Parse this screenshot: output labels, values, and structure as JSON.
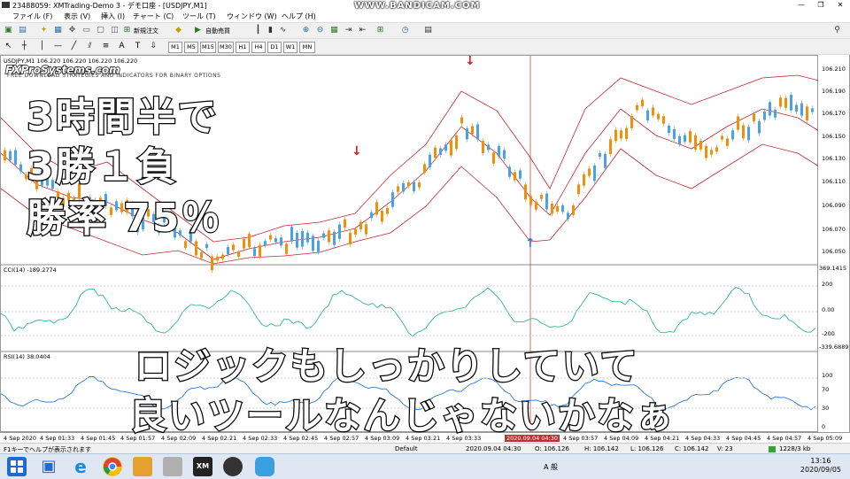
{
  "window": {
    "title": "23488059: XMTrading-Demo 3 - デモ口座 - [USDJPY,M1]",
    "watermark": "WWW.BANDICAM.COM",
    "min": "—",
    "max": "❐",
    "close": "✕"
  },
  "menu": [
    "ファイル (F)",
    "表示 (V)",
    "挿入 (I)",
    "チャート (C)",
    "ツール (T)",
    "ウィンドウ (W)",
    "ヘルプ (H)"
  ],
  "toolbar": {
    "new_order": "新規注文",
    "auto_trade": "自動売買",
    "timeframes": [
      "M1",
      "M5",
      "M15",
      "M30",
      "H1",
      "H4",
      "D1",
      "W1",
      "MN"
    ]
  },
  "chart": {
    "symbol_header": "USDJPY,M1  106.220 106.220 106.220 106.220",
    "brand": "FXProSystems.com",
    "brand_sub": "FREE DOWNLOAD STRATEGIES AND INDICATORS FOR BINARY OPTIONS",
    "price_labels": [
      "106.210",
      "106.190",
      "106.170",
      "106.150",
      "106.130",
      "106.110",
      "106.090",
      "106.070",
      "106.050"
    ],
    "cci_header": "CCI(14) -189.2774",
    "cci_labels": [
      "369.1415",
      "200",
      "0.00",
      "-200",
      "-339.6889"
    ],
    "rsi_header": "RSI(14) 38.0404",
    "rsi_labels": [
      "100",
      "70",
      "30",
      "0"
    ],
    "time_labels": [
      "4 Sep 2020",
      "4 Sep 01:33",
      "4 Sep 01:45",
      "4 Sep 01:57",
      "4 Sep 02:09",
      "4 Sep 02:21",
      "4 Sep 02:33",
      "4 Sep 02:45",
      "4 Sep 02:57",
      "4 Sep 03:09",
      "4 Sep 03:21",
      "4 Sep 03:33",
      "2020.09.04 04:30",
      "4 Sep 03:57",
      "4 Sep 04:09",
      "4 Sep 04:21",
      "4 Sep 04:33",
      "4 Sep 04:45",
      "4 Sep 04:57",
      "4 Sep 05:09"
    ]
  },
  "overlay": {
    "line1": "3時間半で",
    "line2": "3勝１負",
    "line3": "勝率 75％",
    "caption1": "ロジックもしっかりしていて",
    "caption2": "良いツールなんじゃないかなぁ"
  },
  "status": {
    "help": "F1キーでヘルプが表示されます",
    "profile": "Default",
    "datetime": "2020.09.04 04:30",
    "open": "O: 106.126",
    "high": "H: 106.142",
    "low": "L: 106.126",
    "close": "C: 106.142",
    "volume": "V: 23",
    "traffic": "1228/3 kb"
  },
  "taskbar": {
    "time": "13:16",
    "date": "2020/09/05",
    "ime": "A 般"
  },
  "colors": {
    "bull": "#4aa3e0",
    "bear": "#f0900a",
    "band": "#c0282e",
    "cci": "#34b49a",
    "rsi": "#2c7bd1"
  }
}
